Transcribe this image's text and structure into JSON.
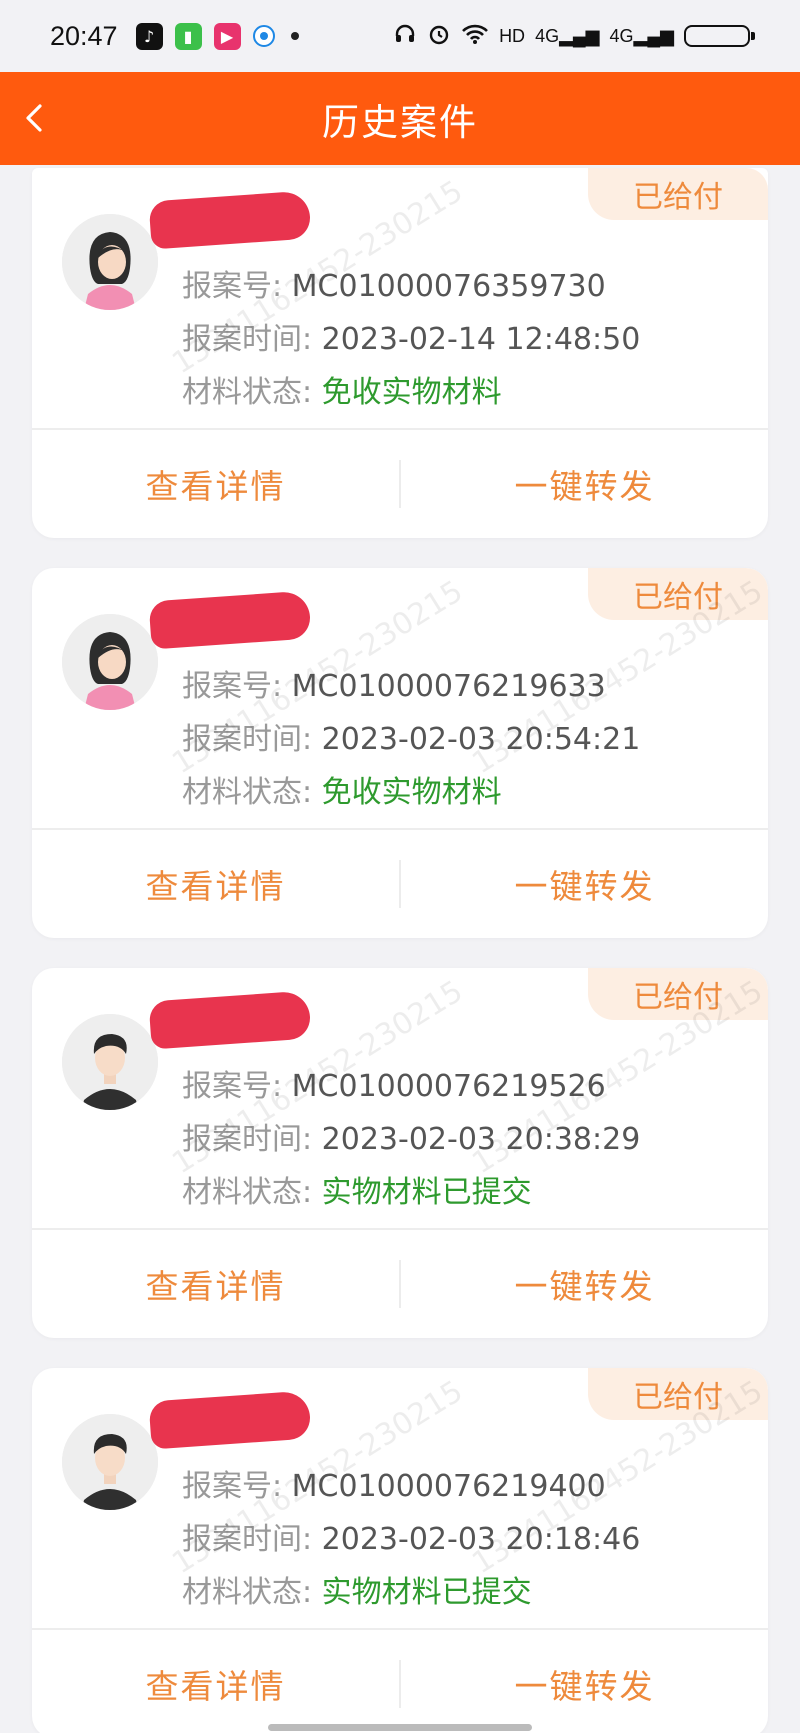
{
  "status_bar": {
    "time": "20:47",
    "network": "HD",
    "signal_1": "4G",
    "signal_2": "4G",
    "battery_level": 0.28
  },
  "header": {
    "title": "历史案件",
    "back_icon": "chevron-left-icon"
  },
  "watermark": "13241162452-230215",
  "cases": [
    {
      "badge": "已给付",
      "avatar": "female",
      "case_no_label": "报案号:",
      "case_no": "MC01000076359730",
      "time_label": "报案时间:",
      "time": "2023-02-14 12:48:50",
      "status_label": "材料状态:",
      "status": "免收实物材料",
      "view_label": "查看详情",
      "forward_label": "一键转发"
    },
    {
      "badge": "已给付",
      "avatar": "female",
      "case_no_label": "报案号:",
      "case_no": "MC01000076219633",
      "time_label": "报案时间:",
      "time": "2023-02-03 20:54:21",
      "status_label": "材料状态:",
      "status": "免收实物材料",
      "view_label": "查看详情",
      "forward_label": "一键转发"
    },
    {
      "badge": "已给付",
      "avatar": "male",
      "case_no_label": "报案号:",
      "case_no": "MC01000076219526",
      "time_label": "报案时间:",
      "time": "2023-02-03 20:38:29",
      "status_label": "材料状态:",
      "status": "实物材料已提交",
      "view_label": "查看详情",
      "forward_label": "一键转发"
    },
    {
      "badge": "已给付",
      "avatar": "male",
      "case_no_label": "报案号:",
      "case_no": "MC01000076219400",
      "time_label": "报案时间:",
      "time": "2023-02-03 20:18:46",
      "status_label": "材料状态:",
      "status": "实物材料已提交",
      "view_label": "查看详情",
      "forward_label": "一键转发"
    }
  ],
  "colors": {
    "header": "#ff5a0e",
    "accent": "#ee8a3c",
    "status_green": "#2e9a2e",
    "badge_bg": "#fdeee2"
  }
}
